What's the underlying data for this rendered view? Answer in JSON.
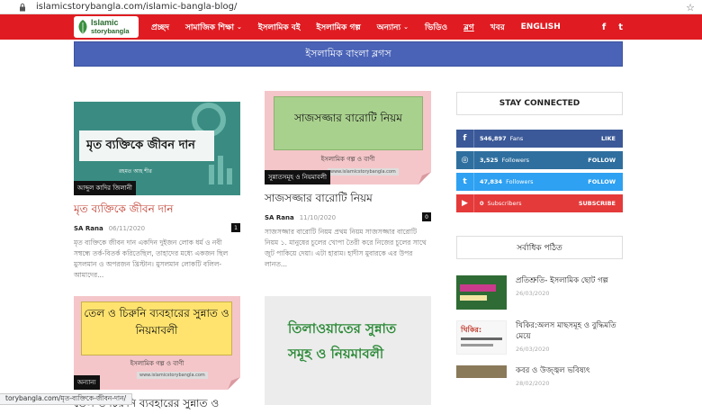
{
  "browser": {
    "url": "islamicstorybangla.com/islamic-bangla-blog/",
    "status_url": "torybangla.com/মৃত-ব্যক্তিকে-জীবন-দান/"
  },
  "nav": {
    "logo_line1": "Islamic",
    "logo_line2": "storybangla",
    "items": [
      {
        "label": "প্রচ্ছদ"
      },
      {
        "label": "সামাজিক শিক্ষা",
        "caret": "⌄"
      },
      {
        "label": "ইসলামিক বই"
      },
      {
        "label": "ইসলামিক গল্প"
      },
      {
        "label": "অন্যান্য",
        "caret": "⌄"
      },
      {
        "label": "ভিডিও"
      },
      {
        "label": "ব্লগ"
      },
      {
        "label": "খবর"
      },
      {
        "label": "ENGLISH"
      }
    ],
    "social": [
      "f",
      "t"
    ]
  },
  "banner": "ইসলামিক বাংলা ব্লগস",
  "posts": [
    {
      "thumb_title": "মৃত ব্যক্তিকে জীবন দান",
      "thumb_sub": "রহমত আহ শীর",
      "category": "আব্দুল কাদির জিলানী",
      "title": "মৃত ব্যক্তিকে জীবন দান",
      "author": "SA Rana",
      "date": "06/11/2020",
      "comments": "1",
      "excerpt": "মৃত ব্যক্তিকে জীবন দান একদিন দুইজন লোক ধর্ম ও নবী সম্বন্ধে তর্ক-বিতর্ক করিতেছিল, তাহাদের মধ্যে একজন ছিল মুসলমান ও অপরজন খ্রিস্টান। মুসলমান লোকটি বলিল- আমাদের..."
    },
    {
      "thumb_title": "সাজসজ্জার বারোটি নিয়ম",
      "thumb_sub": "ইসলামিক গল্প ও বাণী",
      "thumb_url": "www.islamicstorybangla.com",
      "category": "সুন্নাতসমূহ ও নিয়মাবলী",
      "title": "সাজসজ্জার বারোটি নিয়ম",
      "author": "SA Rana",
      "date": "11/10/2020",
      "comments": "0",
      "excerpt": "সাজসজ্জার বারোটি নিয়ম প্রথম নিয়ম সাজসজ্জার বারোটি নিয়ম ১. মানুষের চুলের খোপা তৈরী করে নিজের চুলের সাথে জুট পাকিয়ে দেয়া। এটা হারাম। হাদীস মুবারকে এর উপর লানত..."
    },
    {
      "thumb_title": "তেল ও চিরুনি ব্যবহারের সুন্নাত ও নিয়মাবলী",
      "thumb_sub": "ইসলামিক গল্প ও বাণী",
      "thumb_url": "www.islamicstorybangla.com",
      "category": "অন্যান্য",
      "title": "তেল ও চিরুনি ব্যবহারের সুন্নাত ও"
    },
    {
      "thumb_title": "তিলাওয়াতের সুন্নাত সমূহ ও নিয়মাবলী"
    }
  ],
  "sidebar": {
    "stay_connected": "STAY CONNECTED",
    "social": [
      {
        "icon": "f",
        "count": "546,897",
        "label": "Fans",
        "action": "LIKE",
        "color": "#3b5998"
      },
      {
        "icon": "◎",
        "count": "3,525",
        "label": "Followers",
        "action": "FOLLOW",
        "color": "#2f6f9f"
      },
      {
        "icon": "t",
        "count": "47,834",
        "label": "Followers",
        "action": "FOLLOW",
        "color": "#2ea1f2"
      },
      {
        "icon": "▶",
        "count": "0",
        "label": "Subscribers",
        "action": "SUBSCRIBE",
        "color": "#e53a3a"
      }
    ],
    "popular_title": "সর্বাধিক পঠিত",
    "popular": [
      {
        "title": "প্রতিশ্রুতি- ইসলামিক ছোট গল্প",
        "date": "26/03/2020"
      },
      {
        "title": "খিকির:অলস মাছসমূহ ও বুদ্ধিমতি মেয়ে",
        "date": "26/03/2020",
        "thumb_text": "খিকির:"
      },
      {
        "title": "কবর ও উজ্জ্বল ভবিষ্যৎ",
        "date": "28/02/2020"
      }
    ]
  }
}
